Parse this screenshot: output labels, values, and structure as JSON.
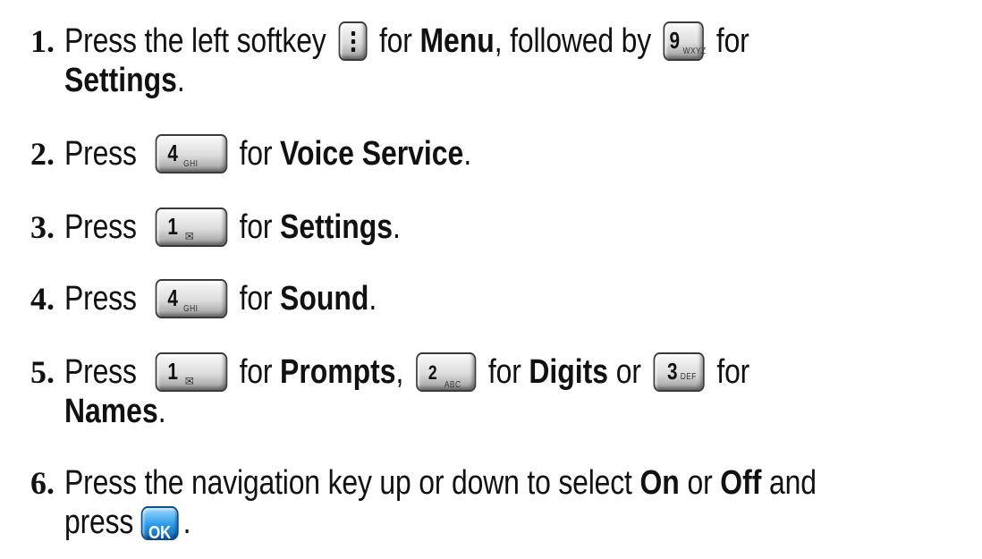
{
  "steps": [
    {
      "num": "1.",
      "line1_a": "Press the left softkey",
      "line1_b": "for",
      "menu": "Menu",
      "line1_c": ", followed by",
      "line1_d": "for",
      "line2_bold": "Settings",
      "line2_end": ".",
      "key1": "",
      "key2": {
        "digit": "9",
        "sub": "WXYZ"
      }
    },
    {
      "num": "2.",
      "a": "Press",
      "b": "for",
      "bold": "Voice Service",
      "end": ".",
      "key": {
        "digit": "4",
        "sub": "GHI"
      }
    },
    {
      "num": "3.",
      "a": "Press",
      "b": "for",
      "bold": "Settings",
      "end": ".",
      "key": {
        "digit": "1",
        "sub": "✉"
      }
    },
    {
      "num": "4.",
      "a": "Press",
      "b": "for",
      "bold": "Sound",
      "end": ".",
      "key": {
        "digit": "4",
        "sub": "GHI"
      }
    },
    {
      "num": "5.",
      "a": "Press",
      "b": "for",
      "bold1": "Prompts",
      "comma": ",",
      "c": "for",
      "bold2": "Digits",
      "or": "or",
      "d": "for",
      "line2_bold": "Names",
      "line2_end": ".",
      "key1": {
        "digit": "1",
        "sub": "✉"
      },
      "key2": {
        "digit": "2",
        "sub": "ABC"
      },
      "key3": {
        "digit": "3",
        "sub": "DEF"
      }
    },
    {
      "num": "6.",
      "a": "Press the navigation key up or down to select",
      "on": "On",
      "or": "or",
      "off": "Off",
      "and": "and",
      "line2": "press",
      "end": ".",
      "ok": "OK"
    }
  ]
}
